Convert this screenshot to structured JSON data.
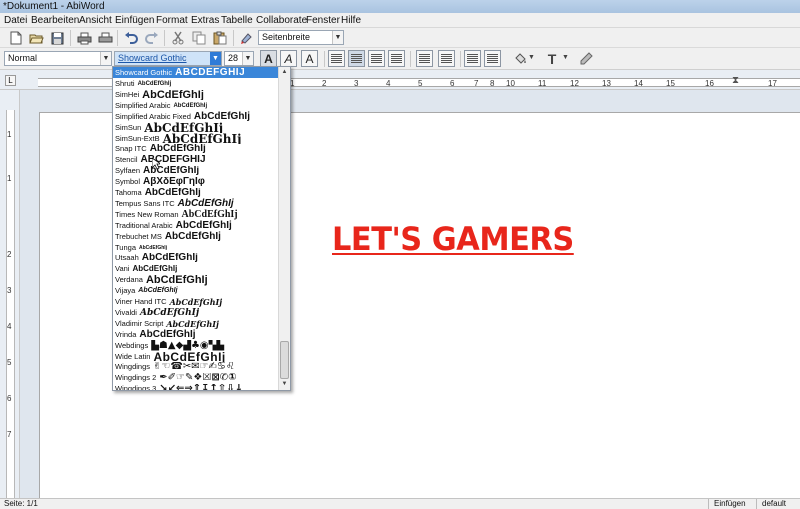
{
  "window": {
    "title": "*Dokument1 - AbiWord"
  },
  "menu": [
    "Datei",
    "Bearbeiten",
    "Ansicht",
    "Einfügen",
    "Format",
    "Extras",
    "Tabelle",
    "Collaborate",
    "Fenster",
    "Hilfe"
  ],
  "toolbar": {
    "icons": [
      "new-document-icon",
      "open-folder-icon",
      "save-icon",
      "print-icon",
      "print-preview-icon",
      "undo-icon",
      "redo-icon",
      "cut-icon",
      "copy-icon",
      "paste-icon",
      "format-painter-icon"
    ],
    "zoom_value": "Seitenbreite"
  },
  "format_toolbar": {
    "style_value": "Normal",
    "font_value": "Showcard Gothic",
    "size_value": "28",
    "bold_label": "A",
    "italic_label": "A",
    "outline_label": "A",
    "text_color_label": "T"
  },
  "font_list": {
    "selected": {
      "name": "Showcard Gothic",
      "sample": "ABCDEFGHIJ"
    },
    "items": [
      {
        "name": "Shruti",
        "sample": "AbCdEfGhIj"
      },
      {
        "name": "SimHei",
        "sample": "AbCdEfGhIj"
      },
      {
        "name": "Simplified Arabic",
        "sample": "AbCdEfGhIj"
      },
      {
        "name": "Simplified Arabic Fixed",
        "sample": "AbCdEfGhIj"
      },
      {
        "name": "SimSun",
        "sample": "AbCdEfGhIj"
      },
      {
        "name": "SimSun-ExtB",
        "sample": "AbCdEfGhIj"
      },
      {
        "name": "Snap ITC",
        "sample": "AbCdEfGhIj"
      },
      {
        "name": "Stencil",
        "sample": "ABCDEFGHIJ"
      },
      {
        "name": "Sylfaen",
        "sample": "AbCdEfGhIj"
      },
      {
        "name": "Symbol",
        "sample": "ΑβΧδΕφΓηΙφ"
      },
      {
        "name": "Tahoma",
        "sample": "AbCdEfGhIj"
      },
      {
        "name": "Tempus Sans ITC",
        "sample": "AbCdEfGhIj"
      },
      {
        "name": "Times New Roman",
        "sample": "AbCdEfGhIj"
      },
      {
        "name": "Traditional Arabic",
        "sample": "AbCdEfGhIj"
      },
      {
        "name": "Trebuchet MS",
        "sample": "AbCdEfGhIj"
      },
      {
        "name": "Tunga",
        "sample": "AbCdEfGhIj"
      },
      {
        "name": "Utsaah",
        "sample": "AbCdEfGhIj"
      },
      {
        "name": "Vani",
        "sample": "AbCdEfGhIj"
      },
      {
        "name": "Verdana",
        "sample": "AbCdEfGhIj"
      },
      {
        "name": "Vijaya",
        "sample": "AbCdEfGhIj"
      },
      {
        "name": "Viner Hand ITC",
        "sample": "AbCdEfGhIj"
      },
      {
        "name": "Vivaldi",
        "sample": "AbCdEfGhIj"
      },
      {
        "name": "Vladimir Script",
        "sample": "AbCdEfGhIj"
      },
      {
        "name": "Vrinda",
        "sample": "AbCdEfGhIj"
      },
      {
        "name": "Webdings",
        "sample": "▙☗▲◆▟♣◉▚▙"
      },
      {
        "name": "Wide Latin",
        "sample": "AbCdEfGhIj"
      },
      {
        "name": "Wingdings",
        "sample": "✌☜☎✂✉☞✍♋♌"
      },
      {
        "name": "Wingdings 2",
        "sample": "✒✐☞✎❖☒⊠✆①"
      },
      {
        "name": "Wingdings 3",
        "sample": "↘↙⇐⇒⇑↧↥⇧⇩↓"
      }
    ]
  },
  "ruler": {
    "h_numbers": [
      "1",
      "2",
      "3",
      "4",
      "5",
      "6",
      "7",
      "8",
      "9",
      "10",
      "11",
      "12",
      "13",
      "14",
      "15",
      "16",
      "17"
    ],
    "v_numbers": [
      "1",
      "1",
      "2",
      "3",
      "4",
      "5",
      "6",
      "7"
    ]
  },
  "document": {
    "text": "LET'S GAMERS"
  },
  "status": {
    "page": "Seite: 1/1",
    "mode": "Einfügen",
    "language": "default"
  },
  "colors": {
    "heading_text": "#e8261b",
    "selection": "#3a86d9"
  }
}
